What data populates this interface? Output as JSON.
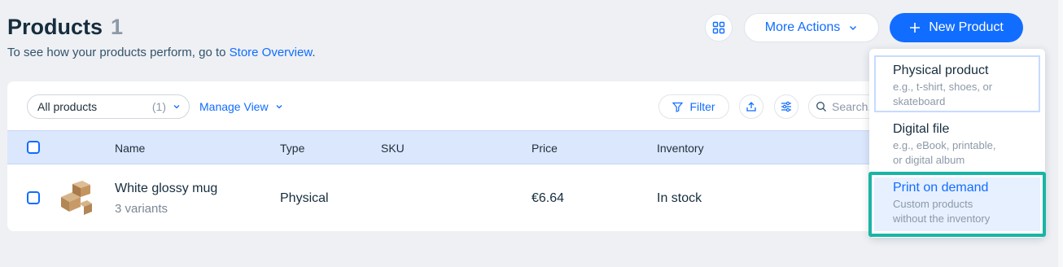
{
  "header": {
    "title": "Products",
    "count": "1",
    "subtitle_prefix": "To see how your products perform, go to ",
    "subtitle_link": "Store Overview",
    "subtitle_suffix": ".",
    "more_actions_label": "More Actions",
    "new_product_label": "New Product"
  },
  "toolbar": {
    "view_select_label": "All products",
    "view_select_count": "(1)",
    "manage_view_label": "Manage View",
    "filter_label": "Filter",
    "search_placeholder": "Search..."
  },
  "table": {
    "columns": [
      "Name",
      "Type",
      "SKU",
      "Price",
      "Inventory"
    ],
    "rows": [
      {
        "name": "White glossy mug",
        "variants": "3 variants",
        "type": "Physical",
        "sku": "",
        "price": "€6.64",
        "inventory": "In stock"
      }
    ]
  },
  "new_product_menu": {
    "items": [
      {
        "title": "Physical product",
        "desc_line1": "e.g., t-shirt, shoes, or",
        "desc_line2": "skateboard"
      },
      {
        "title": "Digital file",
        "desc_line1": "e.g., eBook, printable,",
        "desc_line2": "or digital album"
      },
      {
        "title": "Print on demand",
        "desc_line1": "Custom products",
        "desc_line2": "without the inventory"
      }
    ]
  },
  "colors": {
    "accent": "#116dff",
    "header_row": "#dbe7fd",
    "highlight": "#19b5a5"
  }
}
